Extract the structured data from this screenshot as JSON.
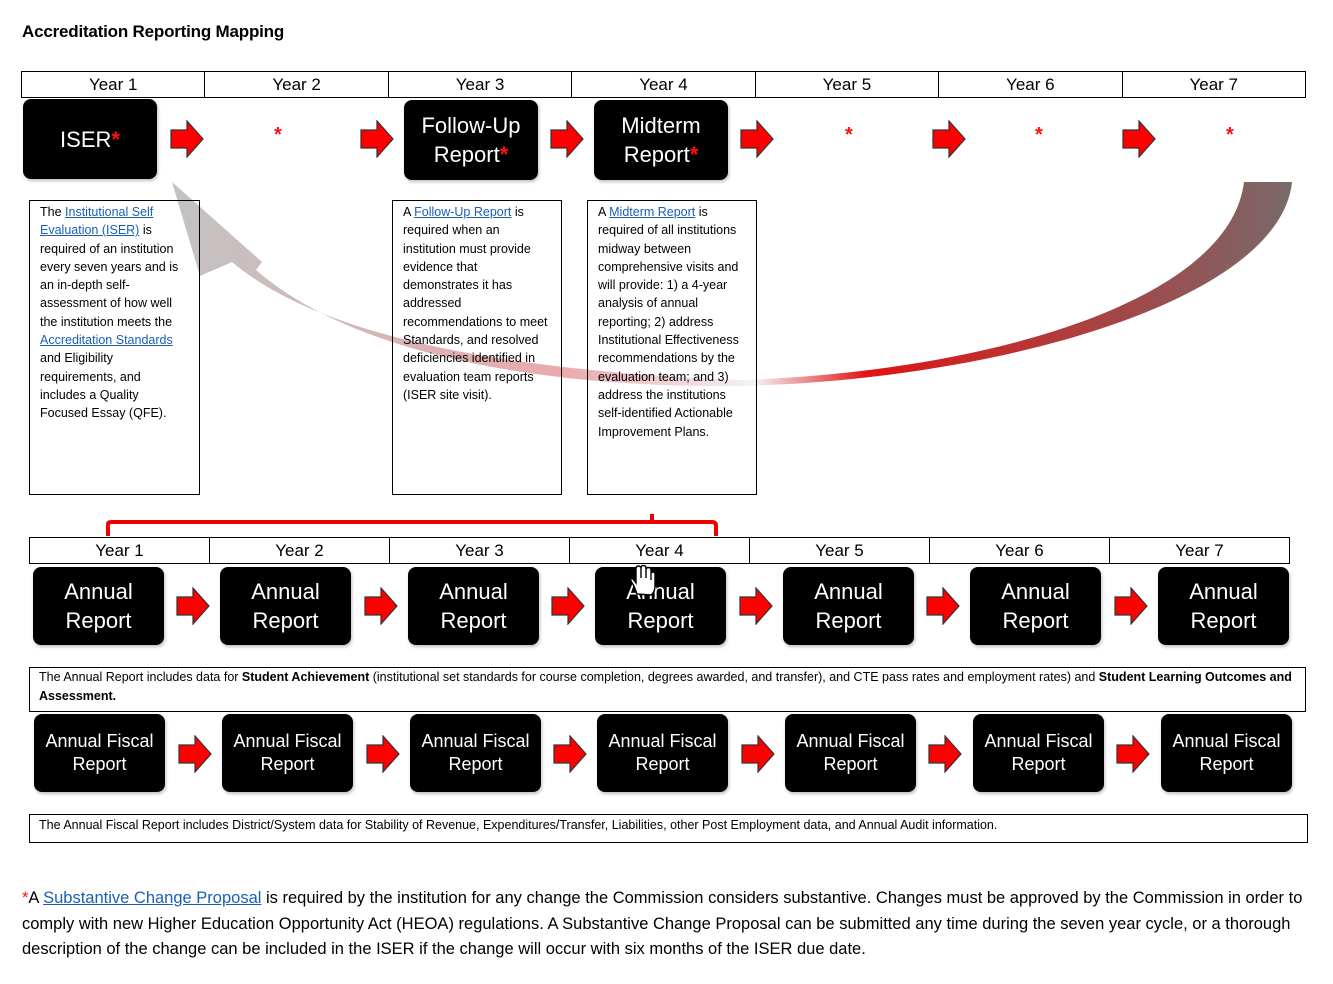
{
  "title": "Accreditation Reporting Mapping",
  "top_timeline": {
    "years": [
      "Year 1",
      "Year 2",
      "Year 3",
      "Year 4",
      "Year 5",
      "Year 6",
      "Year 7"
    ],
    "reports": [
      {
        "year": "Year 1",
        "label_line1": "ISER",
        "label_line2": "",
        "star": "*"
      },
      {
        "year": "Year 3",
        "label_line1": "Follow-Up",
        "label_line2": "Report",
        "star": "*"
      },
      {
        "year": "Year 4",
        "label_line1": "Midterm",
        "label_line2": "Report",
        "star": "*"
      }
    ],
    "empty_year_markers": {
      "year2": "*",
      "year5": "*",
      "year6": "*",
      "year7": "*"
    },
    "cycle_arrow": "Year 7 back to Year 1 (ISER)"
  },
  "descriptions": {
    "iser": {
      "prefix": "The ",
      "link": "Institutional Self Evaluation (ISER)",
      "mid": " is required of an institution every seven years and is an in-depth self-assessment of how well the institution meets the ",
      "link2": "Accreditation Standards",
      "suffix": " and Eligibility requirements, and includes a Quality Focused Essay (QFE)."
    },
    "followup": {
      "prefix": "A ",
      "link": "Follow-Up Report",
      "suffix": " is required when an institution must provide evidence that demonstrates it has addressed recommendations to meet Standards, and resolved deficiencies identified in evaluation team reports (ISER site visit)."
    },
    "midterm": {
      "prefix": "A ",
      "link": "Midterm Report",
      "suffix": " is required of all institutions midway between comprehensive visits and will provide: 1) a 4-year analysis of annual reporting; 2) address Institutional Effectiveness recommendations by the evaluation team; and 3) address  the institutions self-identified Actionable Improvement Plans."
    }
  },
  "annual_timeline": {
    "years": [
      "Year 1",
      "Year 2",
      "Year 3",
      "Year 4",
      "Year 5",
      "Year 6",
      "Year 7"
    ],
    "bracket": "Year 1 through Year 4",
    "report_line1": "Annual",
    "report_line2": "Report",
    "note": {
      "t1": "The Annual Report includes data for ",
      "b1": "Student Achievement",
      "t2": " (institutional set standards for course completion, degrees awarded, and transfer), and CTE pass rates and employment rates) and ",
      "b2": "Student Learning Outcomes and Assessment."
    }
  },
  "fiscal_timeline": {
    "report_line1": "Annual Fiscal",
    "report_line2": "Report",
    "note": "The Annual Fiscal Report includes District/System data for Stability of Revenue, Expenditures/Transfer, Liabilities, other Post Employment data, and Annual Audit information."
  },
  "footer": {
    "star": "*",
    "prefix": "A ",
    "link": "Substantive Change Proposal",
    "text": " is required by the institution for any change the Commission considers substantive. Changes must be approved by the Commission in order to comply with new Higher Education Opportunity Act (HEOA) regulations. A Substantive Change Proposal can be submitted any time during the seven year cycle, or a thorough description of the change can be included in the ISER if the change will occur with six months of the ISER due date."
  },
  "colors": {
    "arrow_red": "#ff0000",
    "star_red": "#ff1010",
    "link_blue": "#1a5fb4",
    "box_black": "#000000"
  }
}
